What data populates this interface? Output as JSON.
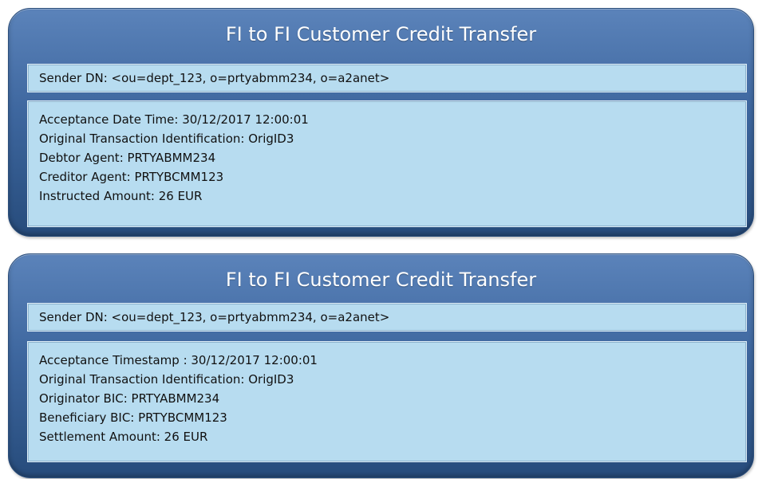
{
  "cards": [
    {
      "title": "FI to FI Customer Credit Transfer",
      "sender": "Sender DN: <ou=dept_123,  o=prtyabmm234,  o=a2anet>",
      "lines": [
        "Acceptance Date Time: 30/12/2017  12:00:01",
        "Original Transaction Identification: OrigID3",
        "Debtor Agent: PRTYABMM234",
        "Creditor Agent: PRTYBCMM123",
        "Instructed Amount: 26 EUR"
      ]
    },
    {
      "title": "FI to FI Customer Credit Transfer",
      "sender": "Sender DN: <ou=dept_123, o=prtyabmm234, o=a2anet>",
      "lines": [
        "Acceptance Timestamp : 30/12/2017  12:00:01",
        "Original Transaction Identification: OrigID3",
        "Originator BIC: PRTYABMM234",
        "Beneficiary BIC: PRTYBCMM123",
        "Settlement Amount: 26 EUR"
      ]
    }
  ]
}
